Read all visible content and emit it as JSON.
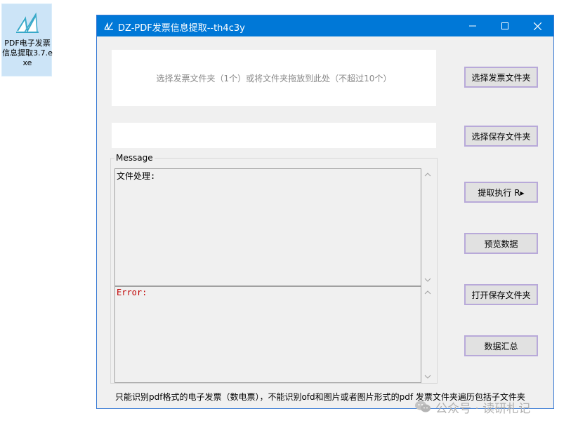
{
  "desktop": {
    "icon_label": "PDF电子发票信息提取3.7.exe",
    "icon": "app-logo-icon"
  },
  "window": {
    "title": "DZ-PDF发票信息提取--th4c3y",
    "controls": {
      "minimize": "minimize-icon",
      "maximize": "maximize-icon",
      "close": "close-icon"
    }
  },
  "dropzone": {
    "hint": "选择发票文件夹（1个）或将文件夹拖放到此处（不超过10个）"
  },
  "save_path": {
    "value": ""
  },
  "message": {
    "legend": "Message",
    "file_log": "文件处理:",
    "error_log": "Error:"
  },
  "buttons": {
    "select_invoice_folder": "选择发票文件夹",
    "select_save_folder": "选择保存文件夹",
    "run_extract": "提取执行 R▸",
    "preview_data": "预览数据",
    "open_save_folder": "打开保存文件夹",
    "data_summary": "数据汇总"
  },
  "footer": {
    "note": "只能识别pdf格式的电子发票（数电票），不能识别ofd和图片或者图片形式的pdf   发票文件夹遍历包括子文件夹"
  },
  "watermark": {
    "text": "公众号 · 读研札记",
    "icon": "wechat-icon"
  },
  "colors": {
    "titlebar": "#0078d7",
    "button_border": "#b8a9d9",
    "error_text": "#c00000"
  }
}
